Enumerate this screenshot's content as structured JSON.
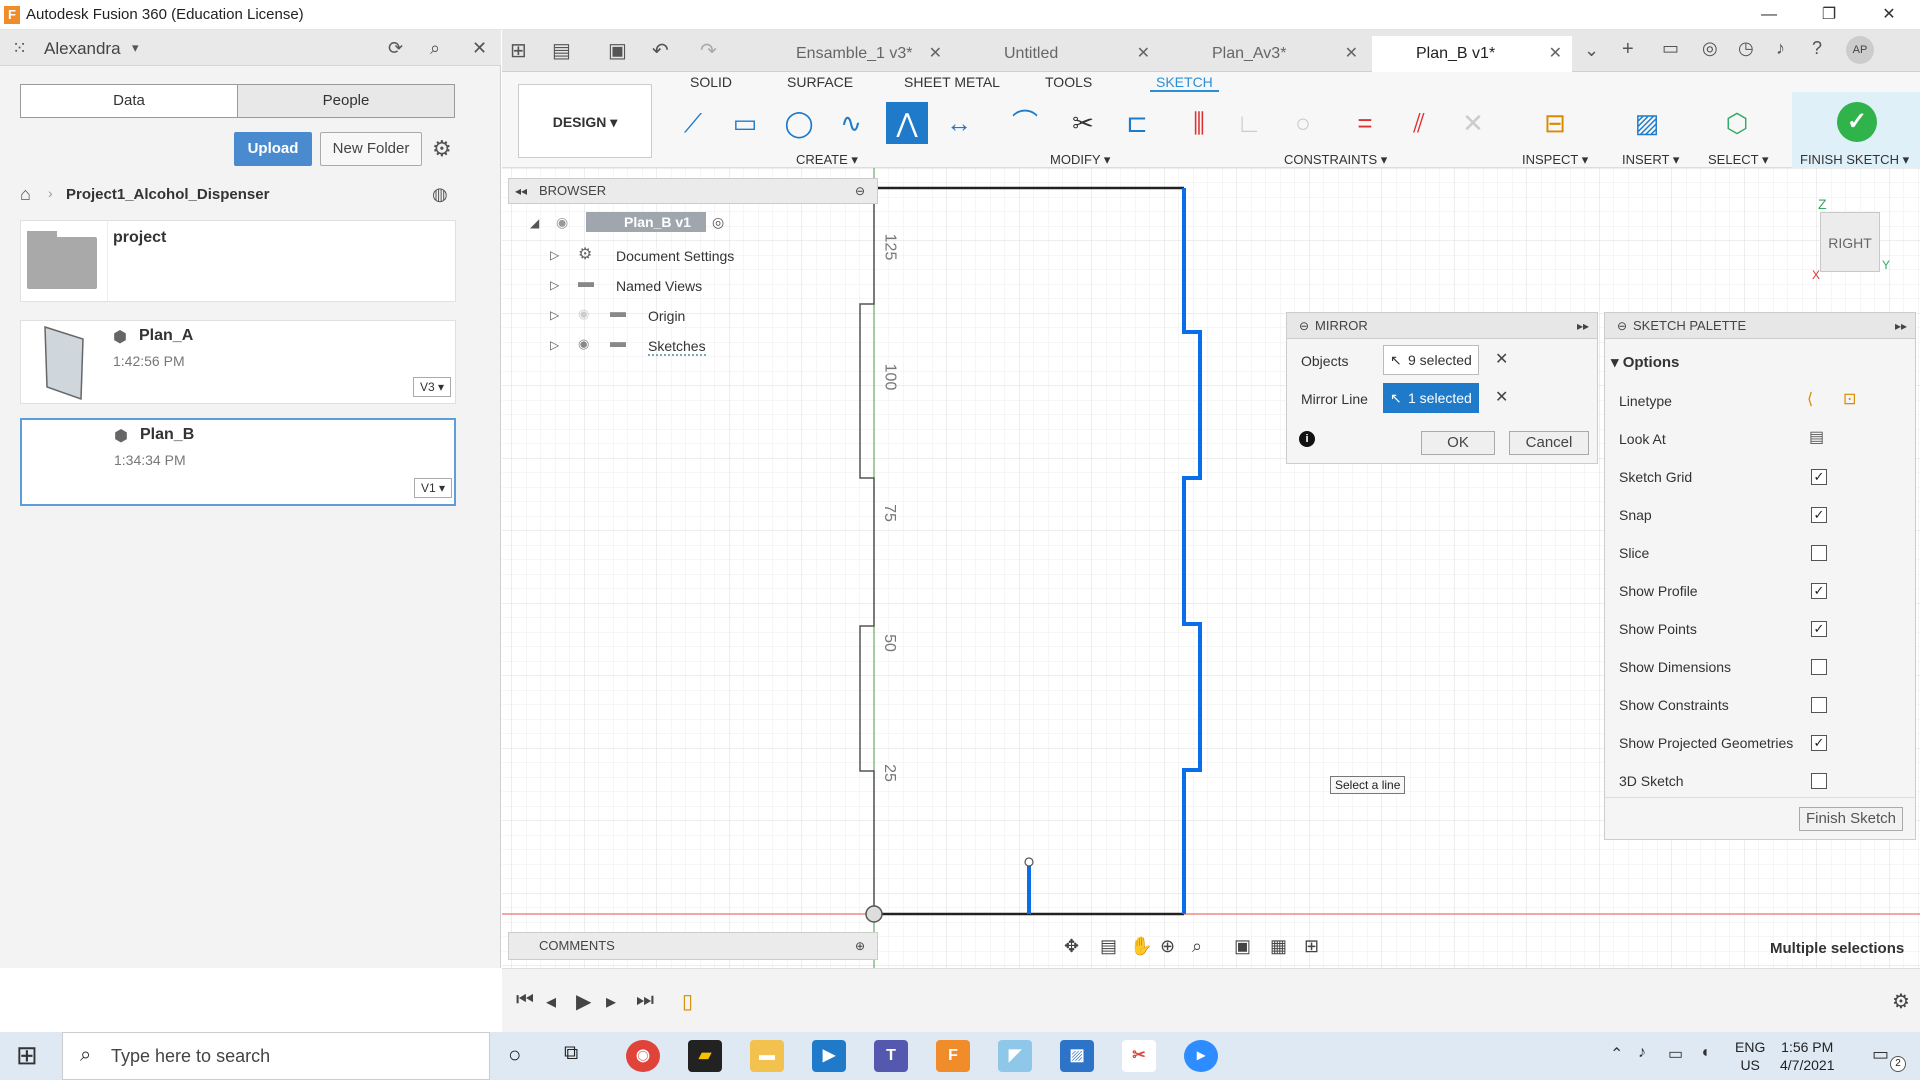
{
  "window": {
    "title": "Autodesk Fusion 360 (Education License)",
    "minimize": "—",
    "restore": "❐",
    "close": "✕"
  },
  "left_panel": {
    "user": "Alexandra",
    "tabs": [
      "Data",
      "People"
    ],
    "upload_label": "Upload",
    "new_folder_label": "New Folder",
    "breadcrumb": "Project1_Alcohol_Dispenser",
    "items": [
      {
        "name": "project",
        "time": "",
        "version": ""
      },
      {
        "name": "Plan_A",
        "time": "1:42:56 PM",
        "version": "V3 ▾"
      },
      {
        "name": "Plan_B",
        "time": "1:34:34 PM",
        "version": "V1 ▾"
      }
    ]
  },
  "doc_tabs": [
    {
      "label": "Ensamble_1 v3*"
    },
    {
      "label": "Untitled"
    },
    {
      "label": "Plan_Av3*"
    },
    {
      "label": "Plan_B v1*"
    }
  ],
  "toolbar": {
    "workspace": "DESIGN ▾",
    "tabs": [
      "SOLID",
      "SURFACE",
      "SHEET METAL",
      "TOOLS",
      "SKETCH"
    ],
    "groups": [
      "CREATE ▾",
      "MODIFY ▾",
      "CONSTRAINTS ▾",
      "INSPECT ▾",
      "INSERT ▾",
      "SELECT ▾",
      "FINISH SKETCH ▾"
    ]
  },
  "browser": {
    "title": "BROWSER",
    "root": "Plan_B v1",
    "items": [
      "Document Settings",
      "Named Views",
      "Origin",
      "Sketches"
    ]
  },
  "mirror": {
    "title": "MIRROR",
    "objects_label": "Objects",
    "objects_value": "9 selected",
    "mirror_line_label": "Mirror Line",
    "mirror_line_value": "1 selected",
    "ok": "OK",
    "cancel": "Cancel"
  },
  "palette": {
    "title": "SKETCH PALETTE",
    "section": "Options",
    "options": [
      {
        "label": "Linetype",
        "checked": null
      },
      {
        "label": "Look At",
        "checked": null
      },
      {
        "label": "Sketch Grid",
        "checked": true
      },
      {
        "label": "Snap",
        "checked": true
      },
      {
        "label": "Slice",
        "checked": false
      },
      {
        "label": "Show Profile",
        "checked": true
      },
      {
        "label": "Show Points",
        "checked": true
      },
      {
        "label": "Show Dimensions",
        "checked": false
      },
      {
        "label": "Show Constraints",
        "checked": false
      },
      {
        "label": "Show Projected Geometries",
        "checked": true
      },
      {
        "label": "3D Sketch",
        "checked": false
      }
    ],
    "finish_label": "Finish Sketch"
  },
  "canvas": {
    "tooltip": "Select a line",
    "ruler_labels": [
      "125",
      "100",
      "75",
      "50",
      "25"
    ],
    "viewcube": "RIGHT",
    "axis_z": "Z",
    "axis_y": "Y",
    "axis_x": "X"
  },
  "comments_label": "COMMENTS",
  "status_text": "Multiple selections",
  "taskbar": {
    "search_placeholder": "Type here to search",
    "lang": "ENG",
    "region": "US",
    "time": "1:56 PM",
    "date": "4/7/2021",
    "notifications": "2"
  },
  "colors": {
    "accent": "#1f7bc9",
    "sketch_line": "#0a6ee8",
    "finish": "#2fb34a"
  }
}
